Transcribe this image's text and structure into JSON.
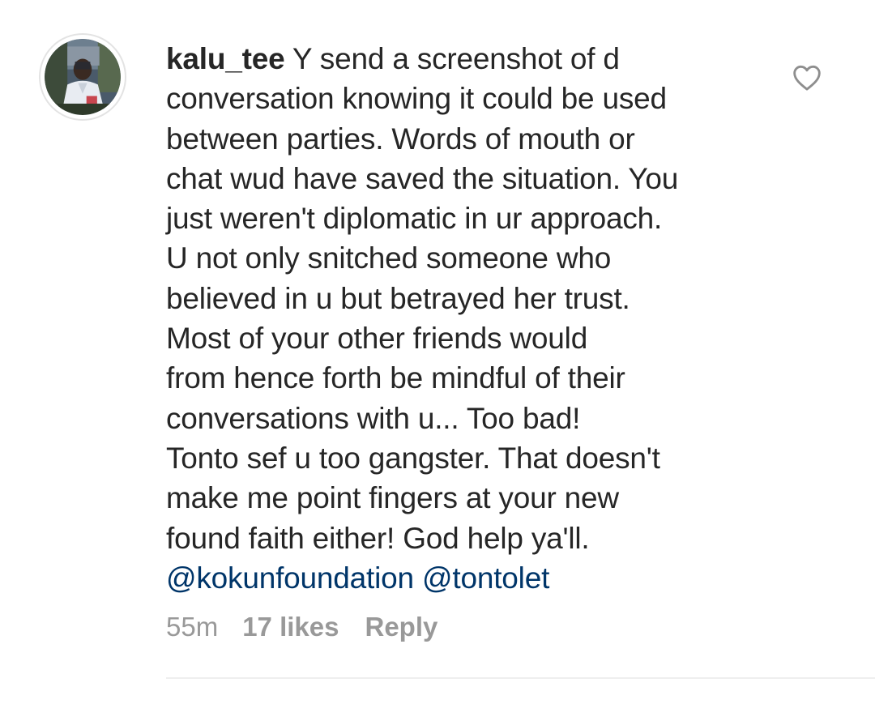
{
  "comment": {
    "username": "kalu_tee",
    "text_lines": [
      "Y send a screenshot of d",
      "conversation knowing it could be used",
      "between parties. Words of mouth or",
      "chat wud have saved the situation. You",
      "just weren't diplomatic in ur approach.",
      "U not only snitched someone who",
      "believed in u but betrayed her trust.",
      "Most of your other friends would",
      "from hence forth be mindful of their",
      "conversations with u... Too bad!",
      "Tonto sef u too gangster. That doesn't",
      "make me point fingers at your new",
      "found faith either! God help ya'll."
    ],
    "mentions": [
      "@kokunfoundation",
      "@tontolet"
    ],
    "time": "55m",
    "likes": "17 likes",
    "reply_label": "Reply",
    "like_icon": "heart-outline-icon"
  },
  "colors": {
    "text": "#262626",
    "mention": "#003569",
    "meta": "#999999",
    "divider": "#efefef"
  }
}
